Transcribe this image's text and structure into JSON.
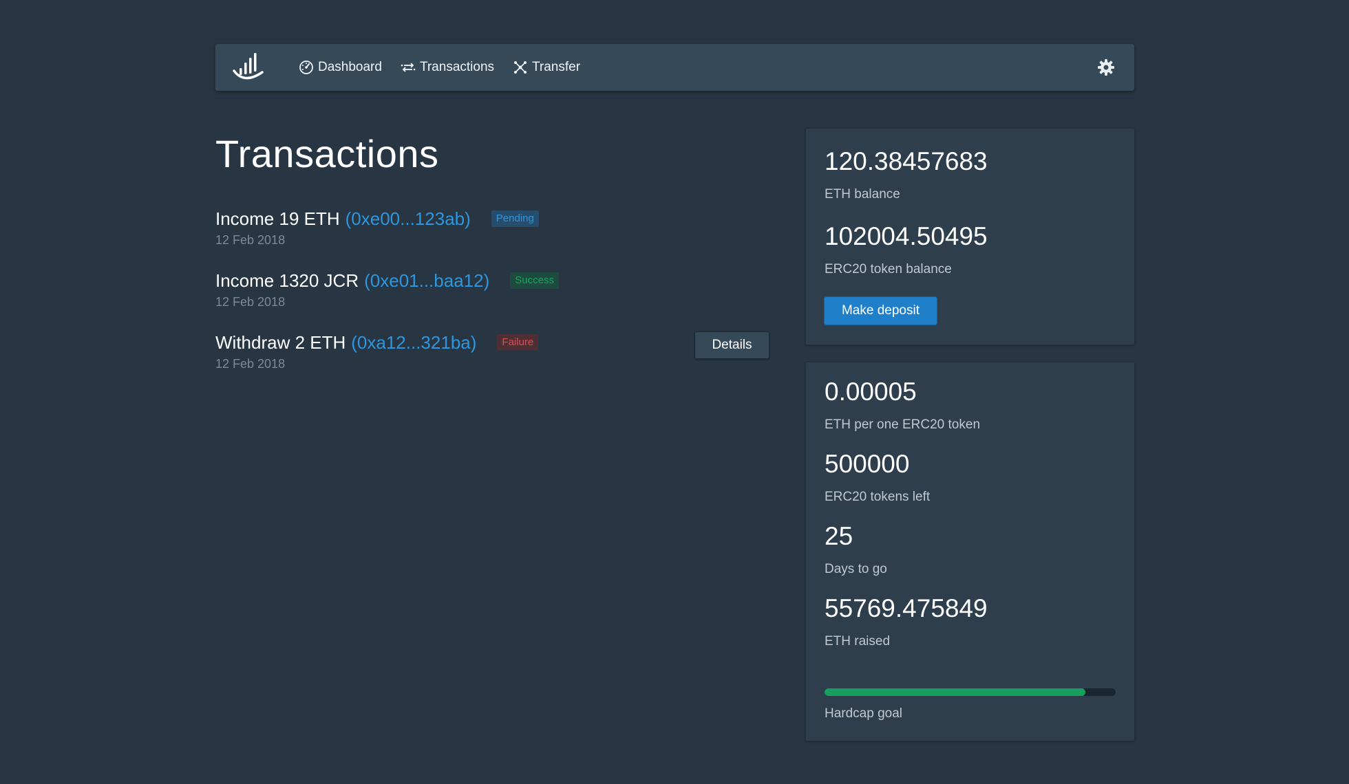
{
  "nav": {
    "items": [
      {
        "label": "Dashboard",
        "icon": "dashboard-gauge-icon"
      },
      {
        "label": "Transactions",
        "icon": "transactions-arrows-icon"
      },
      {
        "label": "Transfer",
        "icon": "transfer-network-icon"
      }
    ],
    "settings_icon": "gear-icon",
    "logo_icon": "logo-chart-icon"
  },
  "page": {
    "title": "Transactions"
  },
  "transactions": [
    {
      "title": "Income 19 ETH",
      "hash": "(0xe00...123ab)",
      "status": "Pending",
      "date": "12 Feb 2018"
    },
    {
      "title": "Income 1320 JCR",
      "hash": "(0xe01...baa12)",
      "status": "Success",
      "date": "12 Feb 2018"
    },
    {
      "title": "Withdraw 2 ETH",
      "hash": "(0xa12...321ba)",
      "status": "Failure",
      "date": "12 Feb 2018",
      "details_label": "Details"
    }
  ],
  "balance_card": {
    "eth_balance_value": "120.38457683",
    "eth_balance_label": "ETH balance",
    "token_balance_value": "102004.50495",
    "token_balance_label": "ERC20 token balance",
    "deposit_label": "Make deposit"
  },
  "sale_card": {
    "rate_value": "0.00005",
    "rate_label": "ETH per one ERC20 token",
    "tokens_left_value": "500000",
    "tokens_left_label": "ERC20 tokens left",
    "days_value": "25",
    "days_label": "Days to go",
    "raised_value": "55769.475849",
    "raised_label": "ETH raised",
    "hardcap_label": "Hardcap goal",
    "hardcap_progress": 0.895
  },
  "colors": {
    "background": "#283542",
    "navbar": "#364959",
    "accent_blue": "#2c97de",
    "success_green": "#17a05d",
    "failure_red": "#e04b4f"
  }
}
